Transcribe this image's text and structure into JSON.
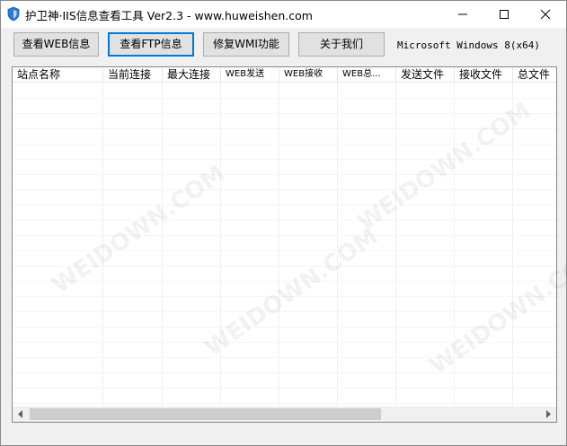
{
  "window": {
    "title": "护卫神·IIS信息查看工具 Ver2.3 - www.huweishen.com",
    "icon": "shield-icon",
    "controls": [
      "minimize-icon",
      "maximize-icon",
      "close-icon"
    ]
  },
  "toolbar": {
    "web_info_label": "查看WEB信息",
    "ftp_info_label": "查看FTP信息",
    "repair_wmi_label": "修复WMI功能",
    "about_label": "关于我们",
    "os_label": "Microsoft Windows 8(x64)"
  },
  "table": {
    "columns": [
      "站点名称",
      "当前连接",
      "最大连接",
      "WEB发送",
      "WEB接收",
      "WEB总...",
      "发送文件",
      "接收文件",
      "总文件"
    ],
    "rows": []
  },
  "watermark": "WEIDOWN.COM",
  "colors": {
    "accent": "#0078d7",
    "button_bg": "#e1e1e1",
    "scroll_thumb": "#cdcdcd"
  }
}
